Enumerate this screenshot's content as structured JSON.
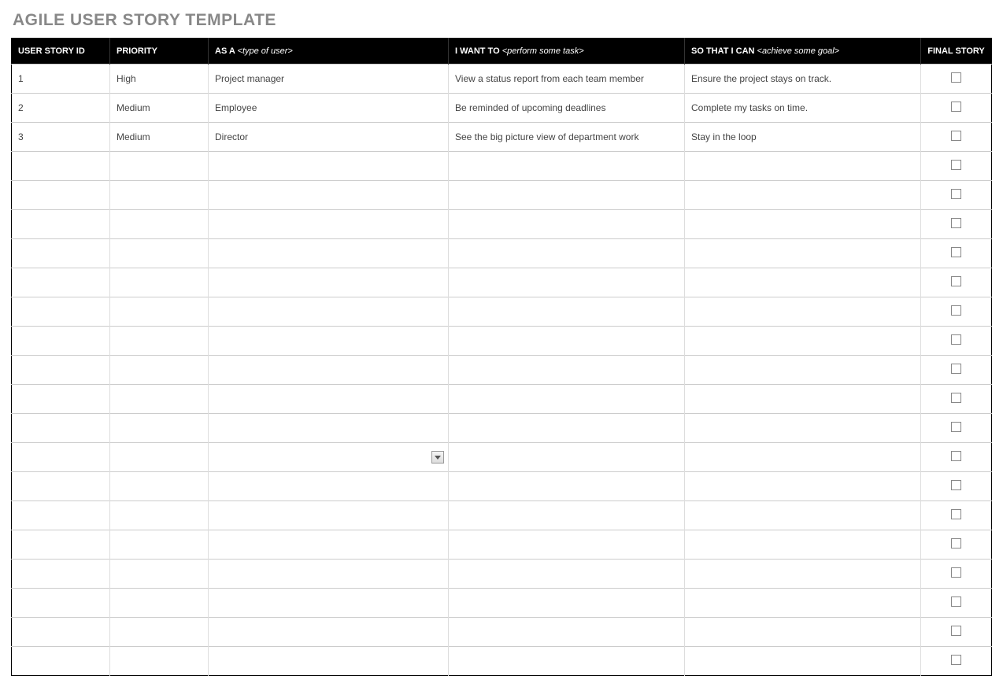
{
  "title": "AGILE USER STORY TEMPLATE",
  "headers": {
    "id": "USER STORY ID",
    "priority": "PRIORITY",
    "asa_prefix": "AS A ",
    "asa_hint": "<type of user>",
    "want_prefix": "I WANT TO ",
    "want_hint": "<perform some task>",
    "sothat_prefix": "SO THAT I CAN ",
    "sothat_hint": "<achieve some goal>",
    "final": "FINAL STORY"
  },
  "rows": [
    {
      "id": "1",
      "priority": "High",
      "asa": "Project manager",
      "want": "View a status report from each team member",
      "sothat": "Ensure the project stays on track.",
      "final": false,
      "dropdown": false
    },
    {
      "id": "2",
      "priority": "Medium",
      "asa": "Employee",
      "want": "Be reminded of upcoming deadlines",
      "sothat": "Complete my tasks on time.",
      "final": false,
      "dropdown": false
    },
    {
      "id": "3",
      "priority": "Medium",
      "asa": "Director",
      "want": "See the big picture view of department work",
      "sothat": "Stay in the loop",
      "final": false,
      "dropdown": false
    },
    {
      "id": "",
      "priority": "",
      "asa": "",
      "want": "",
      "sothat": "",
      "final": false,
      "dropdown": false
    },
    {
      "id": "",
      "priority": "",
      "asa": "",
      "want": "",
      "sothat": "",
      "final": false,
      "dropdown": false
    },
    {
      "id": "",
      "priority": "",
      "asa": "",
      "want": "",
      "sothat": "",
      "final": false,
      "dropdown": false
    },
    {
      "id": "",
      "priority": "",
      "asa": "",
      "want": "",
      "sothat": "",
      "final": false,
      "dropdown": false
    },
    {
      "id": "",
      "priority": "",
      "asa": "",
      "want": "",
      "sothat": "",
      "final": false,
      "dropdown": false
    },
    {
      "id": "",
      "priority": "",
      "asa": "",
      "want": "",
      "sothat": "",
      "final": false,
      "dropdown": false
    },
    {
      "id": "",
      "priority": "",
      "asa": "",
      "want": "",
      "sothat": "",
      "final": false,
      "dropdown": false
    },
    {
      "id": "",
      "priority": "",
      "asa": "",
      "want": "",
      "sothat": "",
      "final": false,
      "dropdown": false
    },
    {
      "id": "",
      "priority": "",
      "asa": "",
      "want": "",
      "sothat": "",
      "final": false,
      "dropdown": false
    },
    {
      "id": "",
      "priority": "",
      "asa": "",
      "want": "",
      "sothat": "",
      "final": false,
      "dropdown": false
    },
    {
      "id": "",
      "priority": "",
      "asa": "",
      "want": "",
      "sothat": "",
      "final": false,
      "dropdown": true
    },
    {
      "id": "",
      "priority": "",
      "asa": "",
      "want": "",
      "sothat": "",
      "final": false,
      "dropdown": false
    },
    {
      "id": "",
      "priority": "",
      "asa": "",
      "want": "",
      "sothat": "",
      "final": false,
      "dropdown": false
    },
    {
      "id": "",
      "priority": "",
      "asa": "",
      "want": "",
      "sothat": "",
      "final": false,
      "dropdown": false
    },
    {
      "id": "",
      "priority": "",
      "asa": "",
      "want": "",
      "sothat": "",
      "final": false,
      "dropdown": false
    },
    {
      "id": "",
      "priority": "",
      "asa": "",
      "want": "",
      "sothat": "",
      "final": false,
      "dropdown": false
    },
    {
      "id": "",
      "priority": "",
      "asa": "",
      "want": "",
      "sothat": "",
      "final": false,
      "dropdown": false
    },
    {
      "id": "",
      "priority": "",
      "asa": "",
      "want": "",
      "sothat": "",
      "final": false,
      "dropdown": false
    }
  ]
}
